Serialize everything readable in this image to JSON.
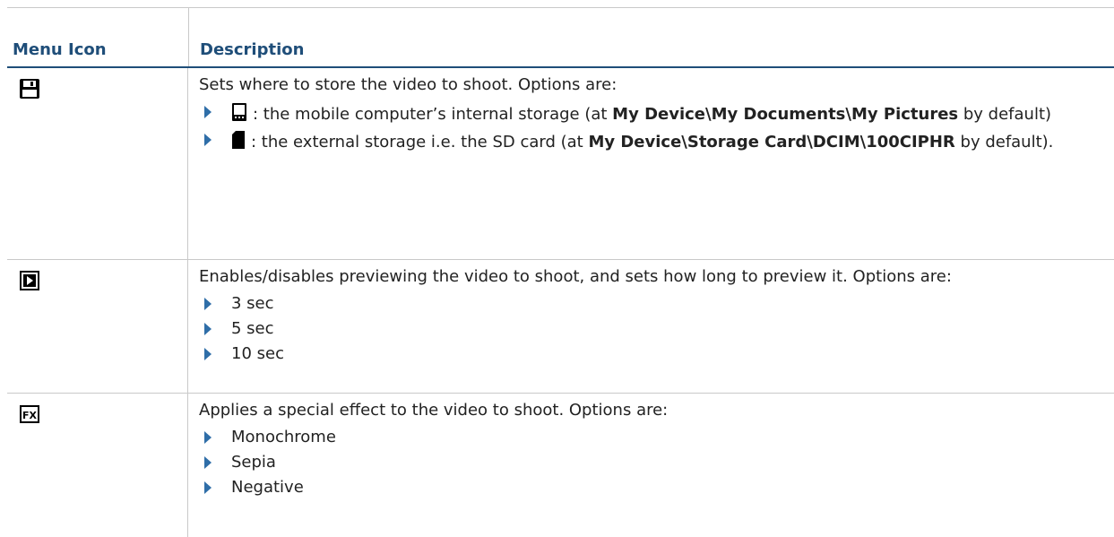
{
  "header": {
    "col1": "Menu Icon",
    "col2": "Description"
  },
  "rows": [
    {
      "icon": "save-floppy-icon",
      "description": "Sets where to store the video to shoot. Options are:",
      "options": [
        {
          "icon": "device-storage-icon",
          "prefix": ": the mobile computer’s internal storage (at ",
          "bold": "My Device\\My Documents\\My Pictures",
          "suffix": " by default)"
        },
        {
          "icon": "sd-card-icon",
          "prefix": ": the external storage i.e. the SD card (at ",
          "bold": "My Device\\Storage Card\\DCIM\\100CIPHR",
          "suffix": " by default)."
        }
      ]
    },
    {
      "icon": "preview-play-icon",
      "description": "Enables/disables previewing the video to shoot, and sets how long to preview it. Options are:",
      "options": [
        "3 sec",
        "5 sec",
        "10 sec"
      ]
    },
    {
      "icon": "fx-effect-icon",
      "description": "Applies a special effect to the video to shoot. Options are:",
      "options": [
        "Monochrome",
        "Sepia",
        "Negative"
      ]
    }
  ]
}
